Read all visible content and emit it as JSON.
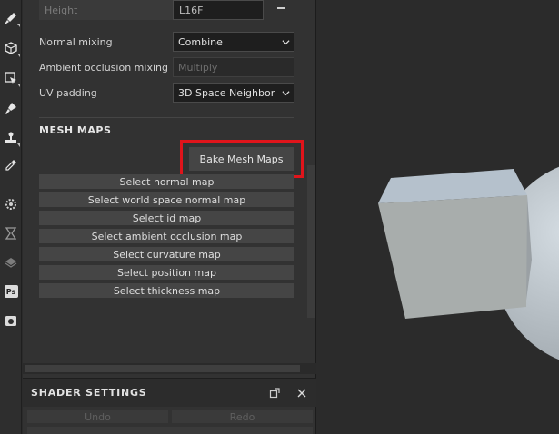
{
  "toolbar": {
    "tools": [
      "paint-brush-icon",
      "cube-select-icon",
      "cursor-select-icon",
      "smudge-icon",
      "stamp-icon",
      "eyedropper-icon",
      "settings-cog-icon",
      "hourglass-icon",
      "layers-icon",
      "photoshop-icon",
      "camera-icon"
    ],
    "ps_label": "Ps"
  },
  "panel": {
    "top_row": {
      "label": "Height",
      "value": "L16F"
    },
    "normal_mixing": {
      "label": "Normal mixing",
      "value": "Combine"
    },
    "ao_mixing": {
      "label": "Ambient occlusion mixing",
      "placeholder": "Multiply"
    },
    "uv_padding": {
      "label": "UV padding",
      "value": "3D Space Neighbor"
    },
    "mesh_maps": {
      "title": "MESH MAPS",
      "bake_label": "Bake Mesh Maps",
      "highlight_color": "#e0141b",
      "map_buttons": [
        "Select normal map",
        "Select world space normal map",
        "Select id map",
        "Select ambient occlusion map",
        "Select curvature map",
        "Select position map",
        "Select thickness map"
      ]
    }
  },
  "shader_settings": {
    "title": "SHADER SETTINGS",
    "undo_label": "Undo",
    "redo_label": "Redo"
  }
}
